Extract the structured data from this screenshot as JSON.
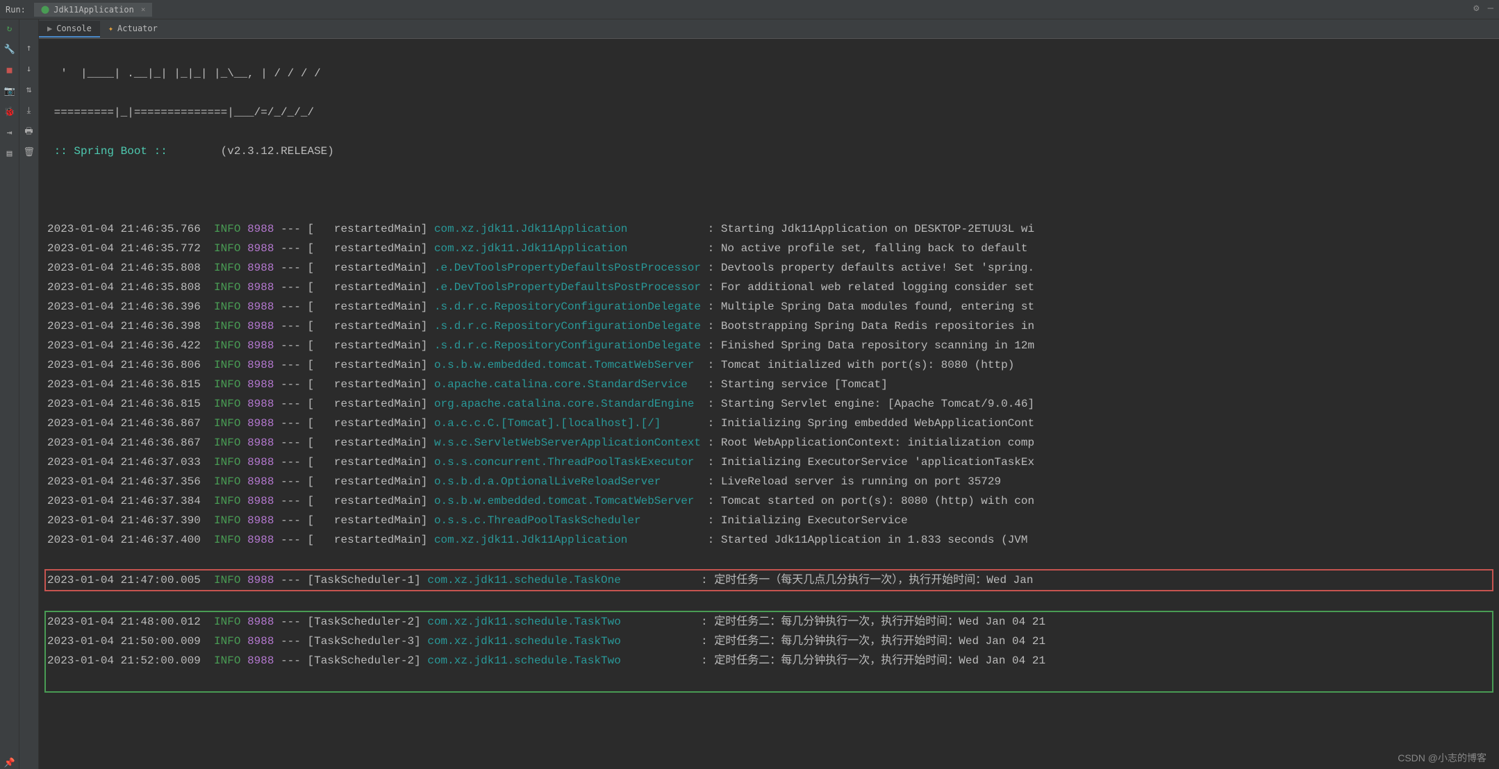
{
  "header": {
    "run_label": "Run:",
    "tab_name": "Jdk11Application"
  },
  "sub_tabs": {
    "console": "Console",
    "actuator": "Actuator"
  },
  "ascii": [
    "  '  |____| .__|_| |_|_| |_\\__, | / / / /",
    " =========|_|==============|___/=/_/_/_/"
  ],
  "boot_label": ":: Spring Boot ::",
  "boot_version": "(v2.3.12.RELEASE)",
  "pid": "8988",
  "level": "INFO",
  "logs": [
    {
      "ts": "2023-01-04 21:46:35.766",
      "thread": "   restartedMain",
      "klass": "com.xz.jdk11.Jdk11Application           ",
      "msg": "Starting Jdk11Application on DESKTOP-2ETUU3L wi"
    },
    {
      "ts": "2023-01-04 21:46:35.772",
      "thread": "   restartedMain",
      "klass": "com.xz.jdk11.Jdk11Application           ",
      "msg": "No active profile set, falling back to default "
    },
    {
      "ts": "2023-01-04 21:46:35.808",
      "thread": "   restartedMain",
      "klass": ".e.DevToolsPropertyDefaultsPostProcessor",
      "msg": "Devtools property defaults active! Set 'spring."
    },
    {
      "ts": "2023-01-04 21:46:35.808",
      "thread": "   restartedMain",
      "klass": ".e.DevToolsPropertyDefaultsPostProcessor",
      "msg": "For additional web related logging consider set"
    },
    {
      "ts": "2023-01-04 21:46:36.396",
      "thread": "   restartedMain",
      "klass": ".s.d.r.c.RepositoryConfigurationDelegate",
      "msg": "Multiple Spring Data modules found, entering st"
    },
    {
      "ts": "2023-01-04 21:46:36.398",
      "thread": "   restartedMain",
      "klass": ".s.d.r.c.RepositoryConfigurationDelegate",
      "msg": "Bootstrapping Spring Data Redis repositories in"
    },
    {
      "ts": "2023-01-04 21:46:36.422",
      "thread": "   restartedMain",
      "klass": ".s.d.r.c.RepositoryConfigurationDelegate",
      "msg": "Finished Spring Data repository scanning in 12m"
    },
    {
      "ts": "2023-01-04 21:46:36.806",
      "thread": "   restartedMain",
      "klass": "o.s.b.w.embedded.tomcat.TomcatWebServer ",
      "msg": "Tomcat initialized with port(s): 8080 (http)"
    },
    {
      "ts": "2023-01-04 21:46:36.815",
      "thread": "   restartedMain",
      "klass": "o.apache.catalina.core.StandardService  ",
      "msg": "Starting service [Tomcat]"
    },
    {
      "ts": "2023-01-04 21:46:36.815",
      "thread": "   restartedMain",
      "klass": "org.apache.catalina.core.StandardEngine ",
      "msg": "Starting Servlet engine: [Apache Tomcat/9.0.46]"
    },
    {
      "ts": "2023-01-04 21:46:36.867",
      "thread": "   restartedMain",
      "klass": "o.a.c.c.C.[Tomcat].[localhost].[/]      ",
      "msg": "Initializing Spring embedded WebApplicationCont"
    },
    {
      "ts": "2023-01-04 21:46:36.867",
      "thread": "   restartedMain",
      "klass": "w.s.c.ServletWebServerApplicationContext",
      "msg": "Root WebApplicationContext: initialization comp"
    },
    {
      "ts": "2023-01-04 21:46:37.033",
      "thread": "   restartedMain",
      "klass": "o.s.s.concurrent.ThreadPoolTaskExecutor ",
      "msg": "Initializing ExecutorService 'applicationTaskEx"
    },
    {
      "ts": "2023-01-04 21:46:37.356",
      "thread": "   restartedMain",
      "klass": "o.s.b.d.a.OptionalLiveReloadServer      ",
      "msg": "LiveReload server is running on port 35729"
    },
    {
      "ts": "2023-01-04 21:46:37.384",
      "thread": "   restartedMain",
      "klass": "o.s.b.w.embedded.tomcat.TomcatWebServer ",
      "msg": "Tomcat started on port(s): 8080 (http) with con"
    },
    {
      "ts": "2023-01-04 21:46:37.390",
      "thread": "   restartedMain",
      "klass": "o.s.s.c.ThreadPoolTaskScheduler         ",
      "msg": "Initializing ExecutorService"
    },
    {
      "ts": "2023-01-04 21:46:37.400",
      "thread": "   restartedMain",
      "klass": "com.xz.jdk11.Jdk11Application           ",
      "msg": "Started Jdk11Application in 1.833 seconds (JVM "
    }
  ],
  "red_log": {
    "ts": "2023-01-04 21:47:00.005",
    "thread": "TaskScheduler-1",
    "klass": "com.xz.jdk11.schedule.TaskOne           ",
    "msg": "定时任务一（每天几点几分执行一次），执行开始时间：Wed Jan "
  },
  "green_logs": [
    {
      "ts": "2023-01-04 21:48:00.012",
      "thread": "TaskScheduler-2",
      "klass": "com.xz.jdk11.schedule.TaskTwo           ",
      "msg": "定时任务二：每几分钟执行一次，执行开始时间：Wed Jan 04 21"
    },
    {
      "ts": "2023-01-04 21:50:00.009",
      "thread": "TaskScheduler-3",
      "klass": "com.xz.jdk11.schedule.TaskTwo           ",
      "msg": "定时任务二：每几分钟执行一次，执行开始时间：Wed Jan 04 21"
    },
    {
      "ts": "2023-01-04 21:52:00.009",
      "thread": "TaskScheduler-2",
      "klass": "com.xz.jdk11.schedule.TaskTwo           ",
      "msg": "定时任务二：每几分钟执行一次，执行开始时间：Wed Jan 04 21"
    }
  ],
  "watermark": "CSDN @小志的博客"
}
